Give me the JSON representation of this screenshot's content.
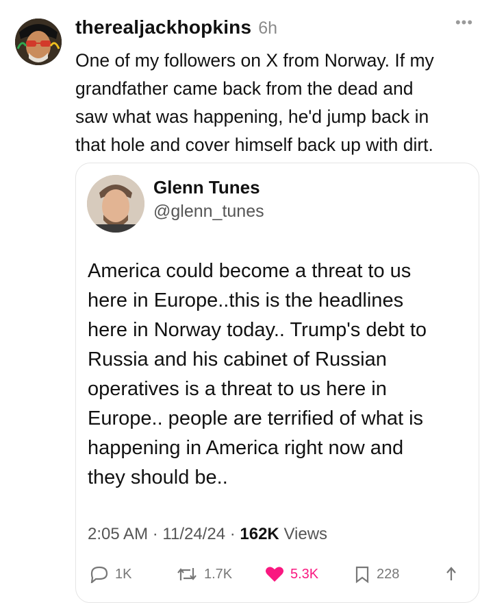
{
  "post": {
    "username": "therealjackhopkins",
    "time": "6h",
    "more_label": "•••",
    "text": "One of my followers on X from Norway. If my\ngrandfather came back from the dead and\nsaw what was happening, he'd jump back in\nthat hole and cover himself back up with dirt."
  },
  "quote": {
    "name": "Glenn Tunes",
    "handle": "@glenn_tunes",
    "text": "America could become a threat to us\nhere in Europe..this is the headlines\nhere in Norway today..  Trump's debt to\nRussia and his cabinet of Russian\noperatives is a threat to us here in\nEurope.. people are terrified of what is\nhappening in America right now and\nthey should be..",
    "time": "2:05 AM",
    "date": "11/24/24",
    "separator": "·",
    "views_count": "162K",
    "views_label": "Views",
    "actions": {
      "replies": "1K",
      "reposts": "1.7K",
      "likes": "5.3K",
      "bookmarks": "228"
    }
  },
  "colors": {
    "like": "#f91880",
    "muted": "#777777"
  },
  "icons": [
    "reply-icon",
    "repost-icon",
    "heart-icon",
    "bookmark-icon",
    "share-icon"
  ]
}
